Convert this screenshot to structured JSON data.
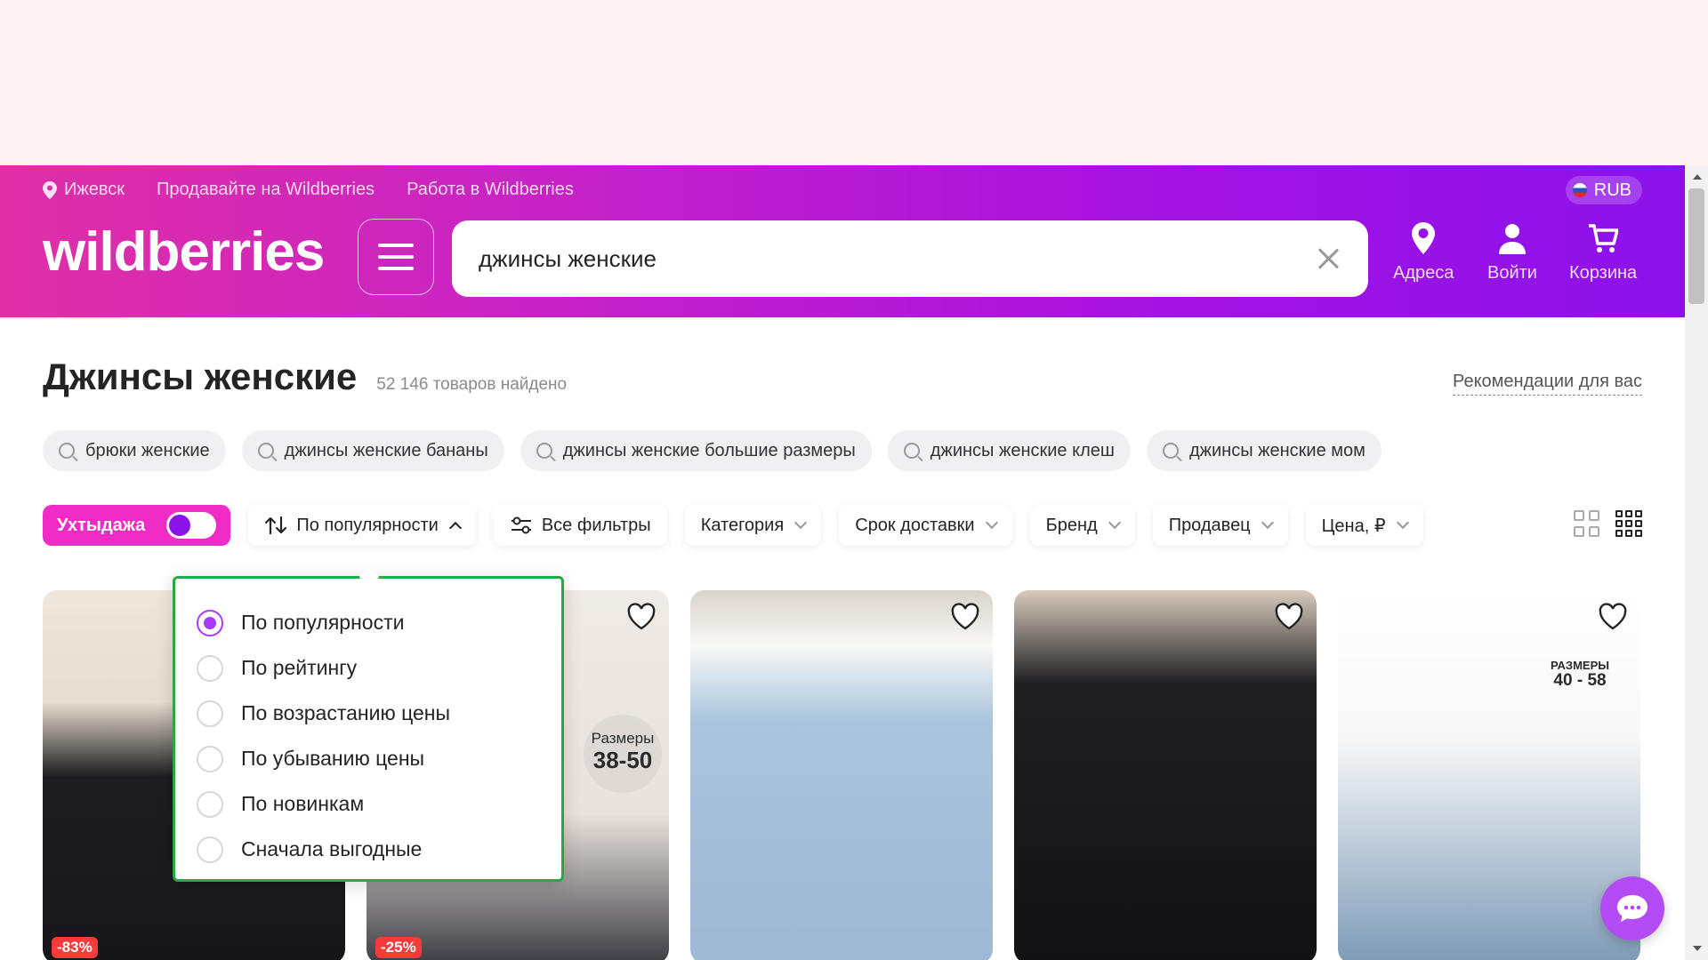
{
  "header": {
    "city": "Ижевск",
    "sell_link": "Продавайте на Wildberries",
    "jobs_link": "Работа в Wildberries",
    "currency": "RUB",
    "logo": "wildberries",
    "search_value": "джинсы женские",
    "addresses_label": "Адреса",
    "login_label": "Войти",
    "cart_label": "Корзина"
  },
  "catalog": {
    "title": "Джинсы женские",
    "found_count": "52 146 товаров найдено",
    "recommendations_link": "Рекомендации для вас"
  },
  "chips": [
    {
      "label": "брюки женские"
    },
    {
      "label": "джинсы женские бананы"
    },
    {
      "label": "джинсы женские большие размеры"
    },
    {
      "label": "джинсы женские клеш"
    },
    {
      "label": "джинсы женские мом"
    }
  ],
  "filters": {
    "hot_deal": "Ухтыдажа",
    "sort": "По популярности",
    "all_filters": "Все фильтры",
    "category": "Категория",
    "delivery": "Срок доставки",
    "brand": "Бренд",
    "seller": "Продавец",
    "price": "Цена, ₽"
  },
  "sort_dropdown": {
    "options": [
      {
        "label": "По популярности",
        "selected": true
      },
      {
        "label": "По рейтингу",
        "selected": false
      },
      {
        "label": "По возрастанию цены",
        "selected": false
      },
      {
        "label": "По убыванию цены",
        "selected": false
      },
      {
        "label": "По новинкам",
        "selected": false
      },
      {
        "label": "Сначала выгодные",
        "selected": false
      }
    ]
  },
  "cards": [
    {
      "discount": "-83%"
    },
    {
      "discount": "-25%",
      "size_line1": "Размеры",
      "size_line2": "38-50"
    },
    {},
    {},
    {
      "size_line1": "РАЗМЕРЫ",
      "size_line2": "40 - 58"
    }
  ],
  "colors": {
    "accent": "#a73afd",
    "hot_deal": "#f12cc6",
    "discount": "#f93a3a",
    "dropdown_outline": "#23a84a"
  }
}
